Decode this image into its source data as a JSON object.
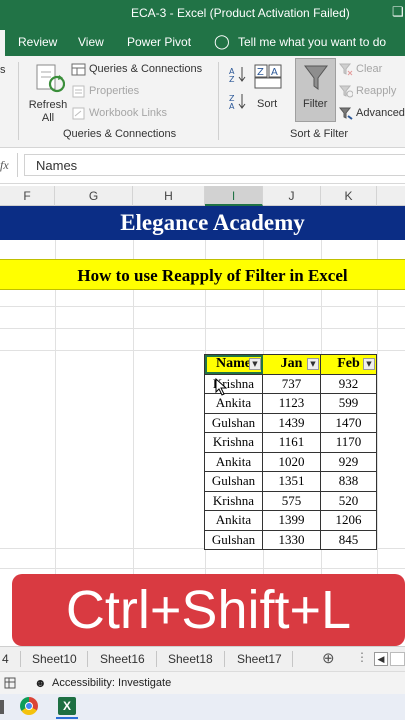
{
  "titlebar": {
    "title": "ECA-3  -  Excel (Product Activation Failed)",
    "restore_icon": "restore-icon"
  },
  "tabs": {
    "items": [
      "Review",
      "View",
      "Power Pivot"
    ],
    "tell_me": "Tell me what you want to do"
  },
  "ribbon": {
    "refresh_all": "Refresh All",
    "queries_connections": "Queries & Connections",
    "properties": "Properties",
    "workbook_links": "Workbook Links",
    "group_queries": "Queries & Connections",
    "sort": "Sort",
    "filter": "Filter",
    "clear": "Clear",
    "reapply": "Reapply",
    "advanced": "Advanced",
    "group_sort": "Sort & Filter",
    "left_cut_label": "s"
  },
  "formula_bar": {
    "fx": "fx",
    "value": "Names"
  },
  "columns": [
    "F",
    "G",
    "H",
    "I",
    "J",
    "K"
  ],
  "sheet": {
    "academy": "Elegance Academy",
    "howto": "How to use Reapply of Filter in Excel",
    "table": {
      "headers": [
        "Name",
        "Jan",
        "Feb"
      ],
      "rows": [
        [
          "Krishna",
          "737",
          "932"
        ],
        [
          "Ankita",
          "1123",
          "599"
        ],
        [
          "Gulshan",
          "1439",
          "1470"
        ],
        [
          "Krishna",
          "1161",
          "1170"
        ],
        [
          "Ankita",
          "1020",
          "929"
        ],
        [
          "Gulshan",
          "1351",
          "838"
        ],
        [
          "Krishna",
          "575",
          "520"
        ],
        [
          "Ankita",
          "1399",
          "1206"
        ],
        [
          "Gulshan",
          "1330",
          "845"
        ]
      ]
    }
  },
  "banner": "Ctrl+Shift+L",
  "sheet_tabs": [
    "4",
    "Sheet10",
    "Sheet16",
    "Sheet18",
    "Sheet17"
  ],
  "status": {
    "accessibility": "Accessibility: Investigate"
  },
  "colors": {
    "excel_green": "#217346",
    "academy_blue": "#0b2d85",
    "highlight_yellow": "#ffff00",
    "banner_red": "#d93a41"
  }
}
